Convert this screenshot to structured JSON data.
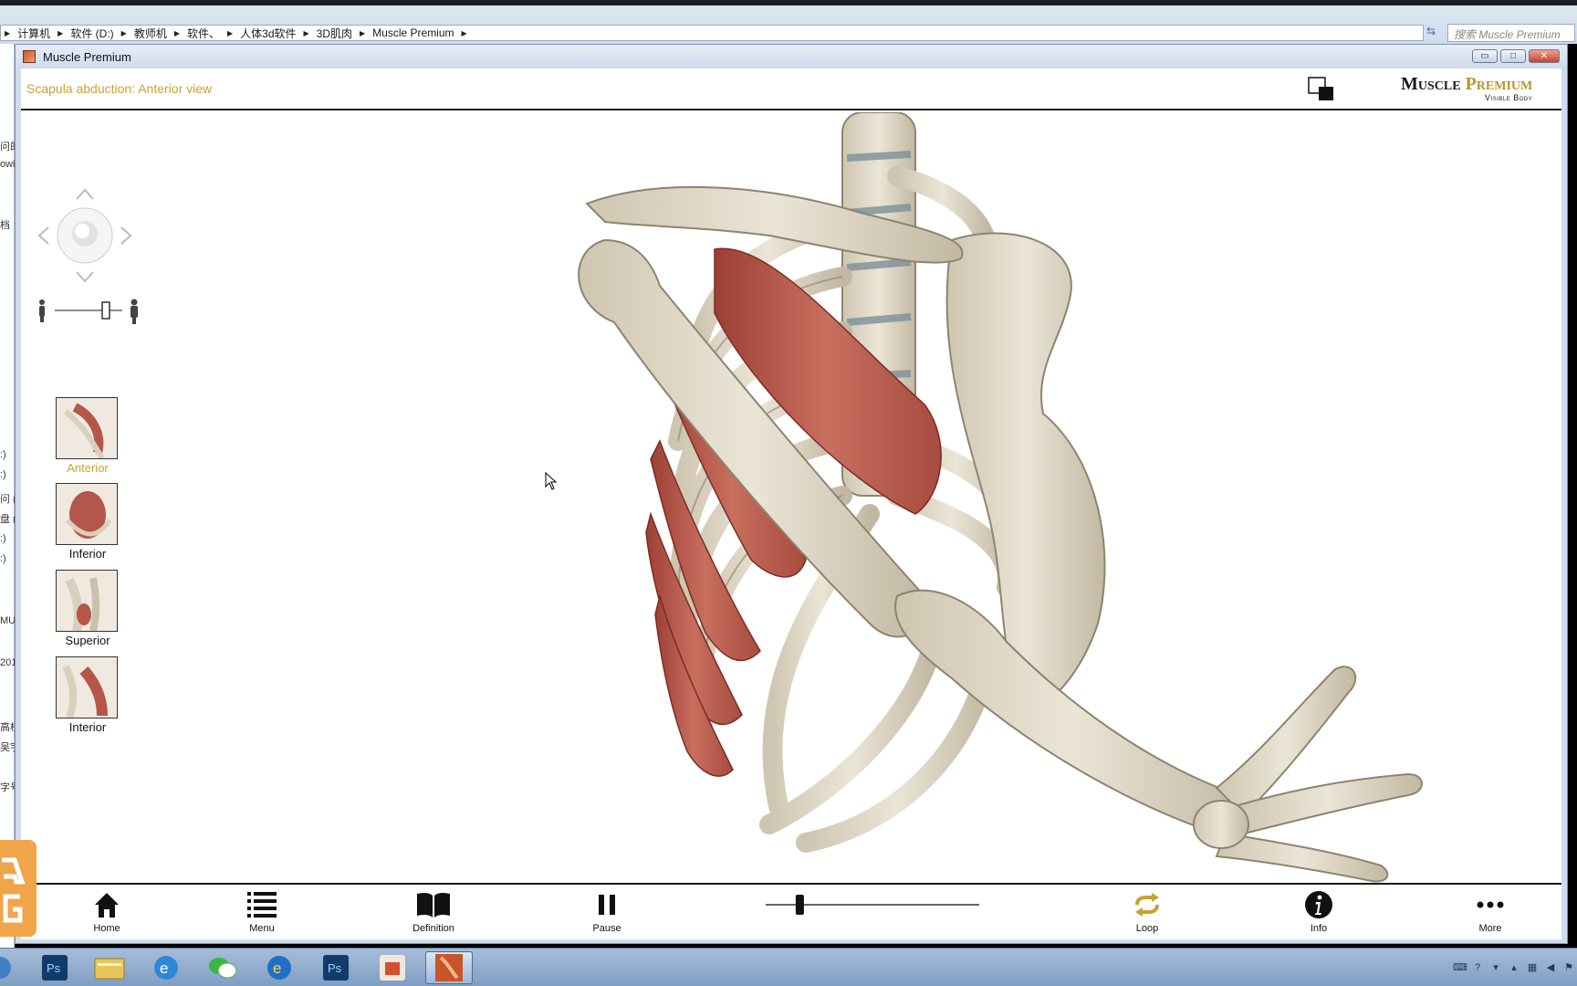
{
  "explorer": {
    "breadcrumb": [
      "计算机",
      "软件 (D:)",
      "教师机",
      "软件、",
      "人体3d软件",
      "3D肌肉",
      "Muscle Premium"
    ],
    "search_placeholder": "搜索 Muscle Premium"
  },
  "window": {
    "title": "Muscle Premium",
    "minimize_label": "▭",
    "restore_label": "□",
    "close_label": "✕"
  },
  "header": {
    "view_title": "Scapula abduction: Anterior view",
    "brand_word1": "Muscle",
    "brand_word2": "Premium",
    "brand_sub": "Visible Body"
  },
  "views": [
    {
      "label": "Anterior",
      "active": true
    },
    {
      "label": "Inferior",
      "active": false
    },
    {
      "label": "Superior",
      "active": false
    },
    {
      "label": "Interior",
      "active": false
    }
  ],
  "toolbar": {
    "home": "Home",
    "menu": "Menu",
    "definition": "Definition",
    "pause": "Pause",
    "loop": "Loop",
    "info": "Info",
    "more": "More"
  },
  "playback": {
    "progress": 0.16
  },
  "colors": {
    "accent_gold": "#c8a331",
    "muscle": "#b5564a",
    "bone": "#e2dbc9"
  },
  "taskbar_apps": [
    "photoshop-icon",
    "explorer-icon",
    "ie-icon",
    "wechat-icon",
    "ie-icon",
    "photoshop-icon",
    "powerpoint-icon",
    "muscle-premium-icon"
  ],
  "sidebar_fragments": [
    "问的",
    "owi",
    "档",
    ":)",
    ":)",
    "问 (",
    "盘 (",
    ":)",
    ":)",
    "MU",
    "201",
    "高校",
    "吴宇",
    "字号"
  ]
}
